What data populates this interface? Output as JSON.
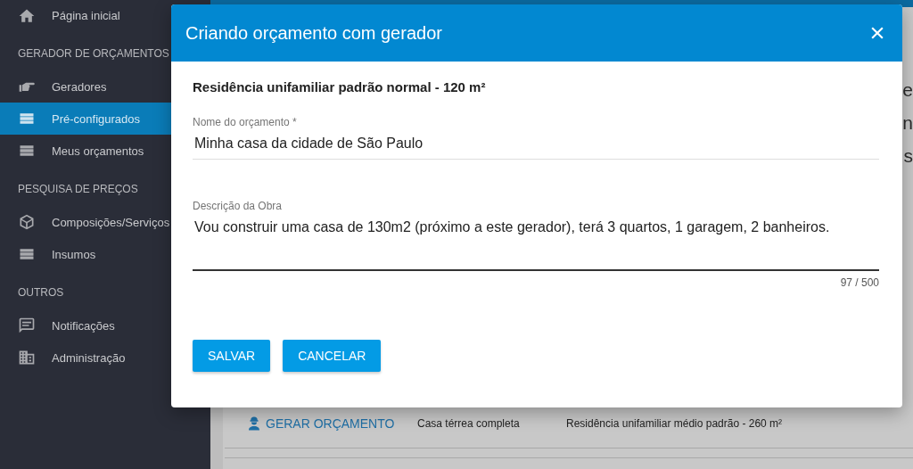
{
  "sidebar": {
    "items": [
      {
        "kind": "link",
        "label": "Página inicial",
        "selected": false
      },
      {
        "kind": "header",
        "label": "GERADOR DE ORÇAMENTOS"
      },
      {
        "kind": "link",
        "label": "Geradores",
        "selected": false
      },
      {
        "kind": "link",
        "label": "Pré-configurados",
        "selected": true
      },
      {
        "kind": "link",
        "label": "Meus orçamentos",
        "selected": false
      },
      {
        "kind": "header",
        "label": "PESQUISA DE PREÇOS"
      },
      {
        "kind": "link",
        "label": "Composições/Serviços",
        "selected": false
      },
      {
        "kind": "link",
        "label": "Insumos",
        "selected": false
      },
      {
        "kind": "header",
        "label": "OUTROS"
      },
      {
        "kind": "link",
        "label": "Notificações",
        "selected": false
      },
      {
        "kind": "link",
        "label": "Administração",
        "selected": false
      }
    ]
  },
  "background_page": {
    "heading_fragments": [
      "e",
      "n",
      "s"
    ],
    "row": {
      "action": "GERAR ORÇAMENTO",
      "name": "Casa térrea completa",
      "description": "Residência unifamiliar médio padrão - 260 m²"
    }
  },
  "dialog": {
    "title": "Criando orçamento com gerador",
    "subtitle": "Residência unifamiliar padrão normal - 120 m²",
    "name_field": {
      "label": "Nome do orçamento *",
      "value": "Minha casa da cidade de São Paulo"
    },
    "description_field": {
      "label": "Descrição da Obra",
      "value": "Vou construir uma casa de 130m2 (próximo a este gerador), terá 3 quartos, 1 garagem, 2 banheiros.",
      "counter": "97 / 500"
    },
    "buttons": [
      "SALVAR",
      "CANCELAR"
    ]
  }
}
